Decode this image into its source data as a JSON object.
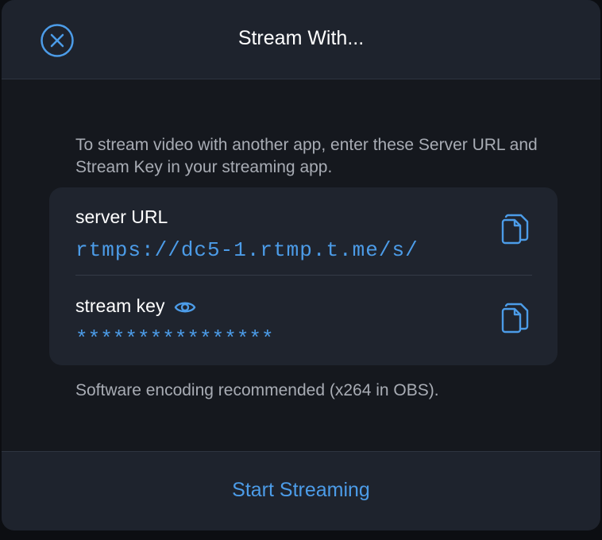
{
  "dialog": {
    "title": "Stream With...",
    "close_icon": "close-circle-icon"
  },
  "description": "To stream video with another app, enter these Server URL and Stream Key in your streaming app.",
  "server": {
    "label": "server URL",
    "value": "rtmps://dc5-1.rtmp.t.me/s/",
    "copy_icon": "copy-icon"
  },
  "key": {
    "label": "stream key",
    "value": "****************",
    "reveal_icon": "eye-icon",
    "copy_icon": "copy-icon"
  },
  "note": "Software encoding recommended (x264 in OBS).",
  "footer": {
    "start_label": "Start Streaming"
  },
  "colors": {
    "accent": "#4c9ce8",
    "background": "#15181e",
    "header": "#1e232d",
    "card": "#1f242e"
  }
}
